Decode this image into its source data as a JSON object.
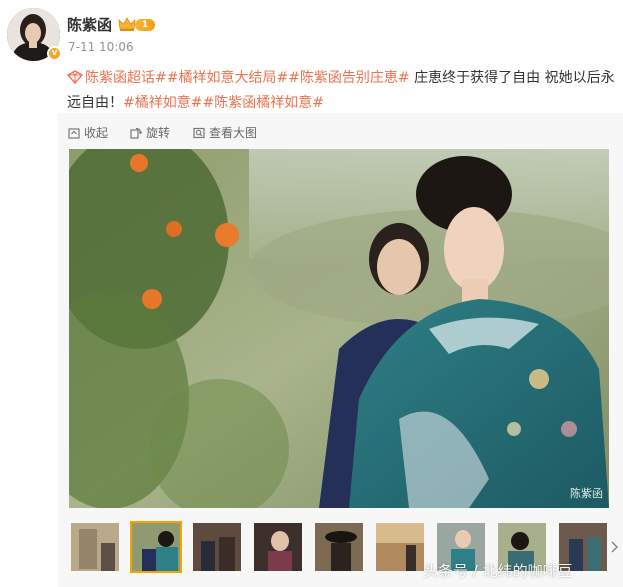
{
  "post": {
    "username": "陈紫函",
    "level": "1",
    "timestamp": "7-11 10:06",
    "text": {
      "topic_1": "陈紫函超话",
      "topic_2": "#橘祥如意大结局#",
      "topic_3": "#陈紫函告别庄恵#",
      "plain_1": " 庄恵终于获得了自由 祝她以后永远自由！",
      "topic_4": "#橘祥如意#",
      "topic_5": "#陈紫函橘祥如意#",
      "topic_1_prefix": "",
      "topic_1_suffix": "#"
    }
  },
  "toolbar": {
    "collect_label": "收起",
    "rotate_label": "旋转",
    "view_large_label": "查看大图"
  },
  "photo": {
    "watermark": "陈紫函"
  },
  "thumbnails": {
    "count": 9,
    "active_index": 1
  },
  "overlay": {
    "source_text": "头条号 / 北纬的咖啡豆"
  },
  "colors": {
    "topic": "#eb7350",
    "active_thumb": "#f7a400",
    "badge": "#f39c12"
  }
}
